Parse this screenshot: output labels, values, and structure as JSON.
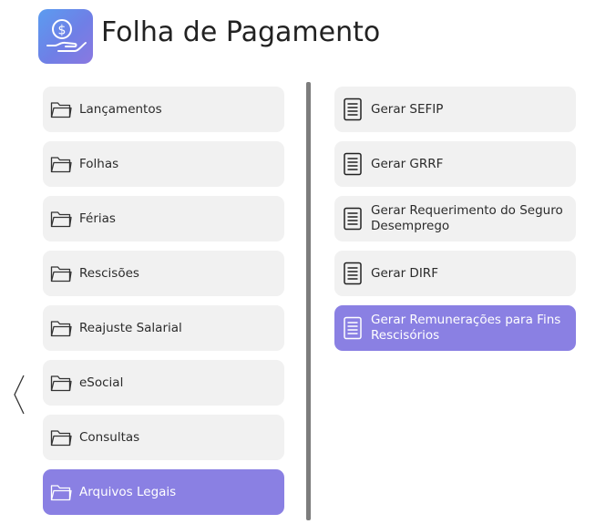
{
  "header": {
    "title": "Folha de Pagamento",
    "icon": "payroll-money-hand-icon"
  },
  "colors": {
    "active": "#8a80e3",
    "item_bg": "#f1f1f1",
    "divider": "#7d7d7d"
  },
  "left_menu": {
    "items": [
      {
        "label": "Lançamentos",
        "icon": "folder-icon",
        "active": false
      },
      {
        "label": "Folhas",
        "icon": "folder-icon",
        "active": false
      },
      {
        "label": "Férias",
        "icon": "folder-icon",
        "active": false
      },
      {
        "label": "Rescisões",
        "icon": "folder-icon",
        "active": false
      },
      {
        "label": "Reajuste Salarial",
        "icon": "folder-icon",
        "active": false
      },
      {
        "label": "eSocial",
        "icon": "folder-icon",
        "active": false
      },
      {
        "label": "Consultas",
        "icon": "folder-icon",
        "active": false
      },
      {
        "label": "Arquivos Legais",
        "icon": "folder-icon",
        "active": true
      }
    ]
  },
  "right_menu": {
    "items": [
      {
        "label": "Gerar SEFIP",
        "icon": "document-icon",
        "active": false
      },
      {
        "label": "Gerar GRRF",
        "icon": "document-icon",
        "active": false
      },
      {
        "label": "Gerar Requerimento do Seguro Desemprego",
        "icon": "document-icon",
        "active": false
      },
      {
        "label": "Gerar DIRF",
        "icon": "document-icon",
        "active": false
      },
      {
        "label": "Gerar Remunerações para Fins Rescisórios",
        "icon": "document-icon",
        "active": true
      }
    ]
  }
}
